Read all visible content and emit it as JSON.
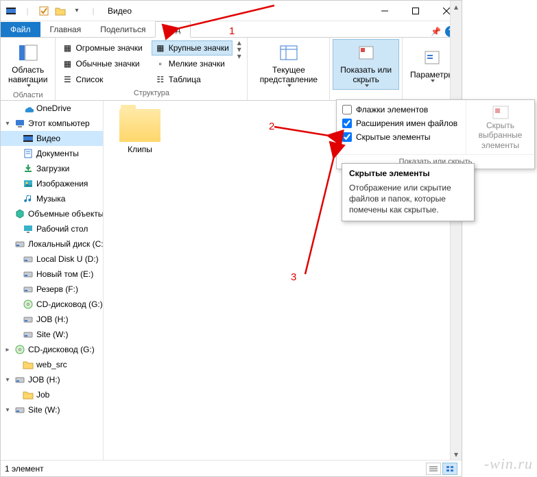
{
  "title": "Видео",
  "quick_access": {
    "pin_expanded": true
  },
  "tabs": {
    "file": "Файл",
    "home": "Главная",
    "share": "Поделиться",
    "view": "Вид",
    "active": "view"
  },
  "ribbon": {
    "panes_group": "Области",
    "panes_btn": "Область навигации",
    "layout_group": "Структура",
    "layouts": {
      "extra_large": "Огромные значки",
      "large": "Крупные значки",
      "medium": "Обычные значки",
      "small": "Мелкие значки",
      "list": "Список",
      "details": "Таблица",
      "selected": "large"
    },
    "current_view_group": "Текущее представление",
    "current_view_btn": "Текущее представление",
    "show_hide_group": "Показать или скрыть",
    "show_hide_btn": "Показать или скрыть",
    "options_btn": "Параметры"
  },
  "dropdown": {
    "checks": [
      {
        "label": "Флажки элементов",
        "checked": false
      },
      {
        "label": "Расширения имен файлов",
        "checked": true
      },
      {
        "label": "Скрытые элементы",
        "checked": true
      }
    ],
    "hide_selected": "Скрыть выбранные элементы",
    "footer": "Показать или скрыть"
  },
  "tooltip": {
    "title": "Скрытые элементы",
    "body": "Отображение или скрытие файлов и папок, которые помечены как скрытые."
  },
  "sidebar": [
    {
      "label": "OneDrive",
      "icon": "cloud",
      "indent": 1
    },
    {
      "label": "Этот компьютер",
      "icon": "pc",
      "indent": 0,
      "exp": "▾"
    },
    {
      "label": "Видео",
      "icon": "video",
      "indent": 1,
      "selected": true
    },
    {
      "label": "Документы",
      "icon": "docs",
      "indent": 1
    },
    {
      "label": "Загрузки",
      "icon": "downloads",
      "indent": 1
    },
    {
      "label": "Изображения",
      "icon": "pictures",
      "indent": 1
    },
    {
      "label": "Музыка",
      "icon": "music",
      "indent": 1
    },
    {
      "label": "Объемные объекты",
      "icon": "3d",
      "indent": 1
    },
    {
      "label": "Рабочий стол",
      "icon": "desktop",
      "indent": 1
    },
    {
      "label": "Локальный диск (C:)",
      "icon": "disk",
      "indent": 1
    },
    {
      "label": "Local Disk U (D:)",
      "icon": "disk",
      "indent": 1
    },
    {
      "label": "Новый том (E:)",
      "icon": "disk",
      "indent": 1
    },
    {
      "label": "Резерв (F:)",
      "icon": "disk",
      "indent": 1
    },
    {
      "label": "CD-дисковод (G:)",
      "icon": "cd",
      "indent": 1
    },
    {
      "label": "JOB (H:)",
      "icon": "disk",
      "indent": 1
    },
    {
      "label": "Site (W:)",
      "icon": "disk",
      "indent": 1
    },
    {
      "label": "CD-дисковод (G:)",
      "icon": "cd",
      "indent": 0,
      "exp": "▸"
    },
    {
      "label": "web_src",
      "icon": "folder",
      "indent": 1
    },
    {
      "label": "JOB (H:)",
      "icon": "disk",
      "indent": 0,
      "exp": "▾"
    },
    {
      "label": "Job",
      "icon": "folder",
      "indent": 1
    },
    {
      "label": "Site (W:)",
      "icon": "disk",
      "indent": 0,
      "exp": "▾"
    }
  ],
  "content": {
    "items": [
      {
        "label": "Клипы",
        "type": "folder"
      }
    ]
  },
  "statusbar": {
    "count": "1 элемент"
  },
  "annotations": {
    "n1": "1",
    "n2": "2",
    "n3": "3"
  },
  "watermark": "-win.ru"
}
